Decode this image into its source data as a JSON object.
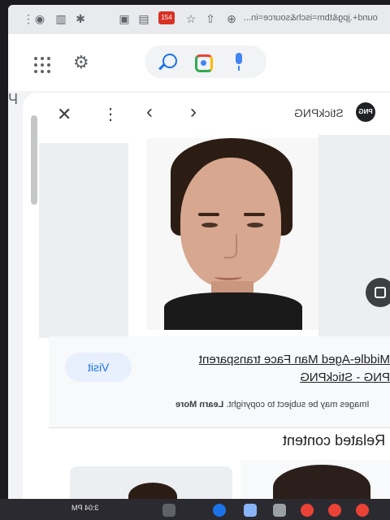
{
  "toolbar": {
    "url_fragment": "ound+.jpg&tbm=isch&source=in...",
    "badge": "154"
  },
  "left_fragment": "Ч",
  "panel": {
    "source_name": "StickPNG",
    "source_logo_text": "PNG",
    "title_line1": "Middle-Aged Man Face transparent",
    "title_line2": "PNG - StickPNG",
    "visit_label": "Visit",
    "copyright": "Images may be subject to copyright.",
    "learn_more": "Learn More",
    "related_heading": "Related content"
  },
  "taskbar": {
    "clock": "3:04 PM"
  },
  "icons": {
    "close": "close-icon",
    "more": "more-vert-icon",
    "prev": "chevron-left-icon",
    "next": "chevron-right-icon",
    "lens": "google-lens-icon",
    "search": "search-icon",
    "mic": "mic-icon",
    "settings": "gear-icon",
    "apps": "apps-grid-icon"
  },
  "colors": {
    "accent": "#1a73e8",
    "visit_bg": "#e8f0fe"
  }
}
